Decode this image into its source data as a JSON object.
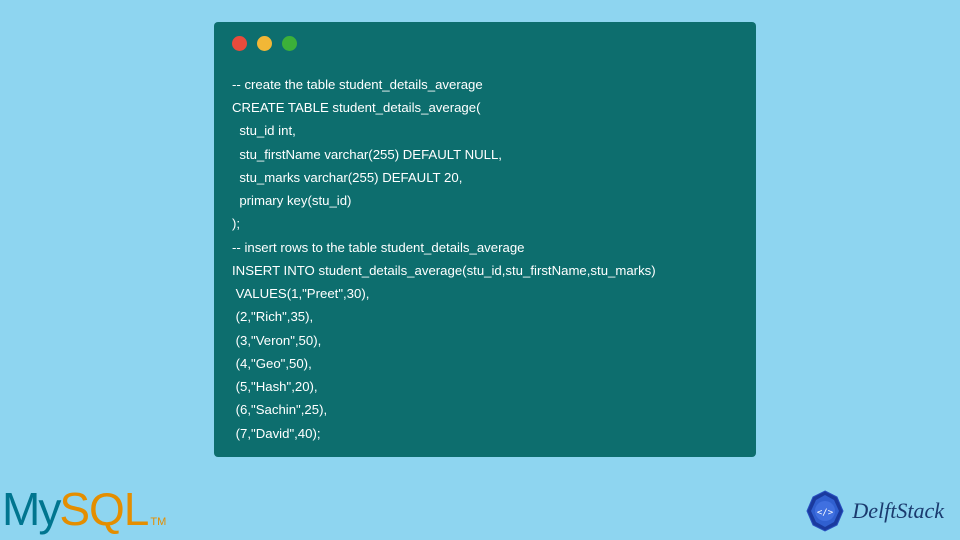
{
  "code": {
    "lines": [
      "-- create the table student_details_average",
      "CREATE TABLE student_details_average(",
      "  stu_id int,",
      "  stu_firstName varchar(255) DEFAULT NULL,",
      "  stu_marks varchar(255) DEFAULT 20,",
      "  primary key(stu_id)",
      ");",
      "-- insert rows to the table student_details_average",
      "INSERT INTO student_details_average(stu_id,stu_firstName,stu_marks)",
      " VALUES(1,\"Preet\",30),",
      " (2,\"Rich\",35),",
      " (3,\"Veron\",50),",
      " (4,\"Geo\",50),",
      " (5,\"Hash\",20),",
      " (6,\"Sachin\",25),",
      " (7,\"David\",40);"
    ]
  },
  "logos": {
    "mysql_my": "My",
    "mysql_sql": "SQL",
    "mysql_tm": "TM",
    "delftstack": "DelftStack"
  }
}
